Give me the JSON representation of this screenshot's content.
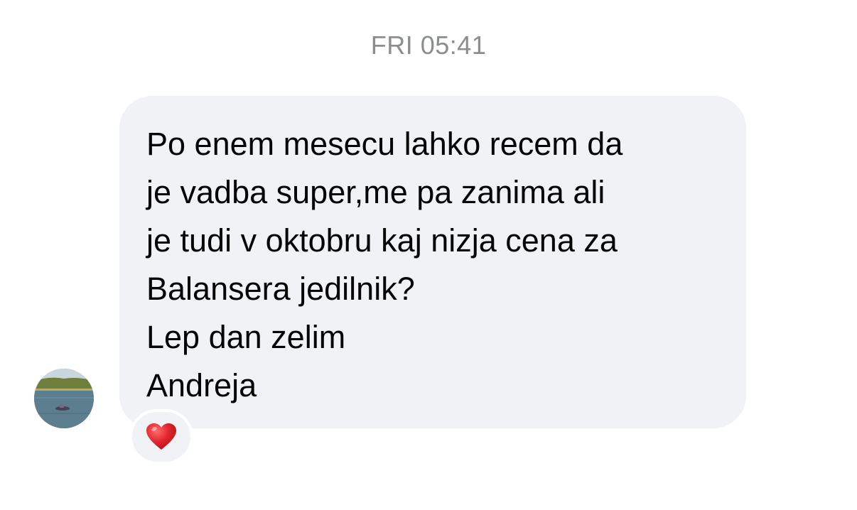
{
  "chat": {
    "timestamp": "FRI 05:41",
    "message": {
      "lines": [
        "Po enem mesecu lahko recem da",
        "je vadba super,me pa zanima ali",
        "je tudi v oktobru kaj nizja cena za",
        "Balansera jedilnik?",
        "Lep dan zelim",
        "Andreja"
      ],
      "reaction_icon": "red-heart-icon"
    },
    "colors": {
      "bubble": "#f1f2f6",
      "timestamp": "#8a8d91",
      "text": "#050505",
      "heart": "#e0242c"
    }
  }
}
